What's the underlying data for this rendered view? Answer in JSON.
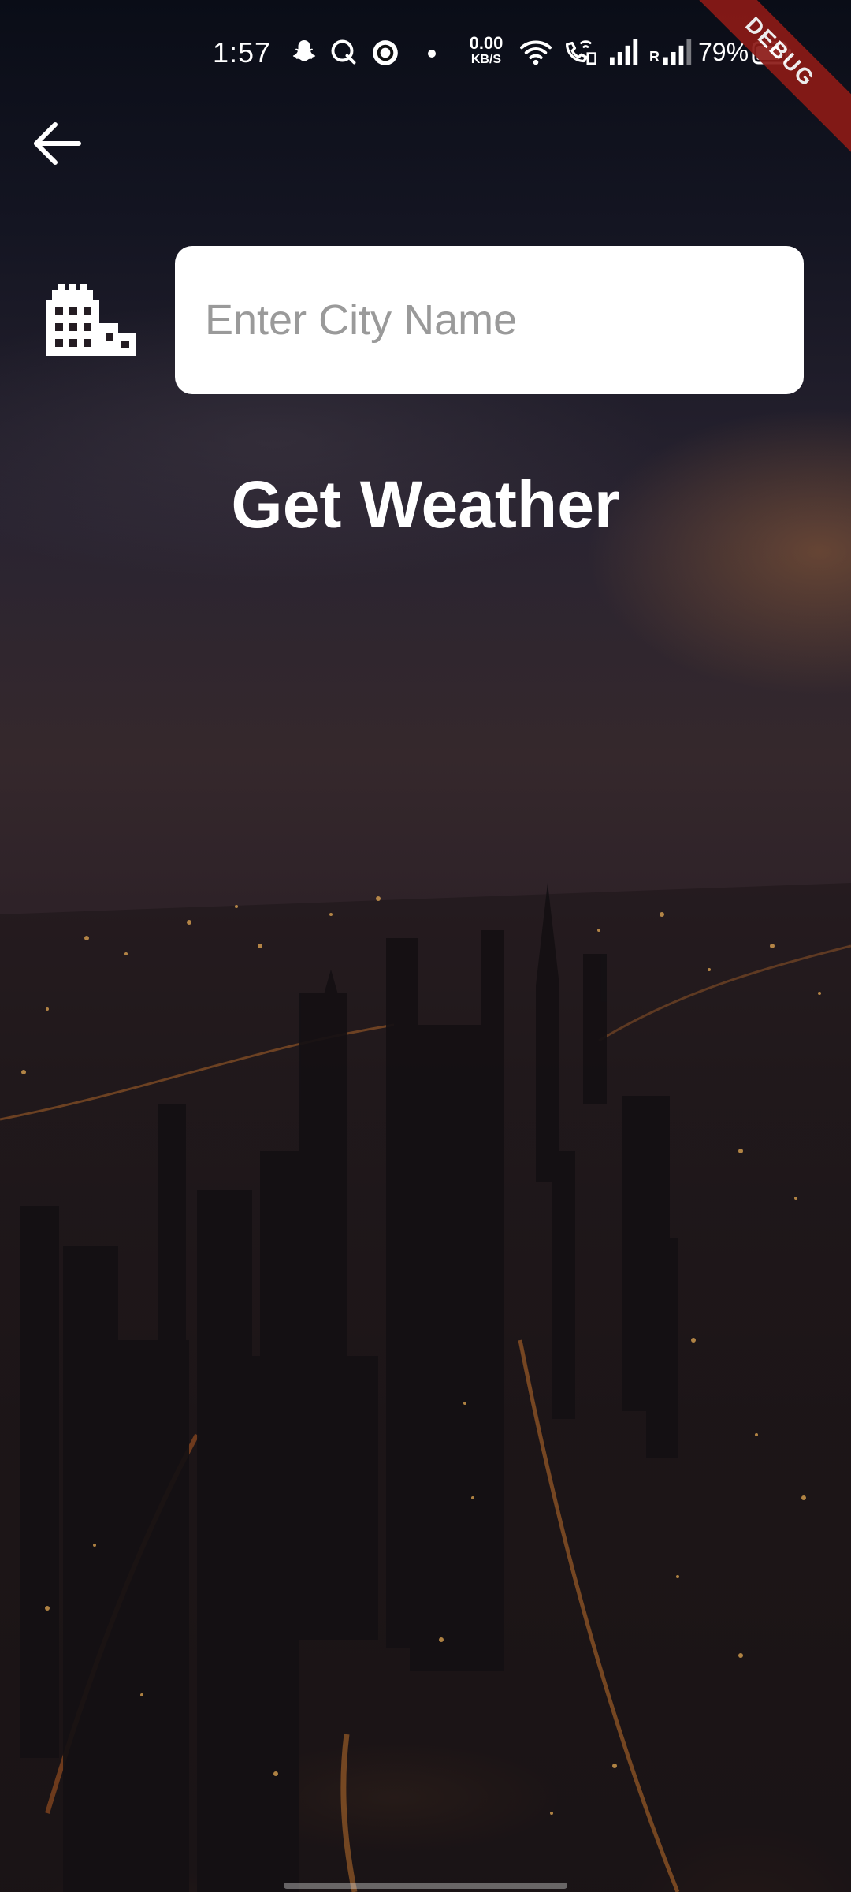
{
  "status_bar": {
    "time": "1:57",
    "net_speed_value": "0.00",
    "net_speed_unit": "KB/S",
    "signal_label": "R",
    "battery_percent": "79%",
    "icons": [
      "snapchat-icon",
      "q-app-icon",
      "circle-app-icon",
      "dot-icon",
      "wifi-icon",
      "wifi-calling-icon",
      "signal-icon",
      "signal-roaming-icon",
      "battery-icon"
    ]
  },
  "debug_banner": "DEBUG",
  "back_button": {
    "icon": "arrow-left-icon"
  },
  "city_input": {
    "icon": "city-building-icon",
    "placeholder": "Enter City Name",
    "value": ""
  },
  "get_weather_button": {
    "label": "Get Weather"
  },
  "colors": {
    "text": "#ffffff",
    "input_bg": "#ffffff",
    "placeholder": "#9a9a9a",
    "debug_banner": "#8b1a16"
  }
}
